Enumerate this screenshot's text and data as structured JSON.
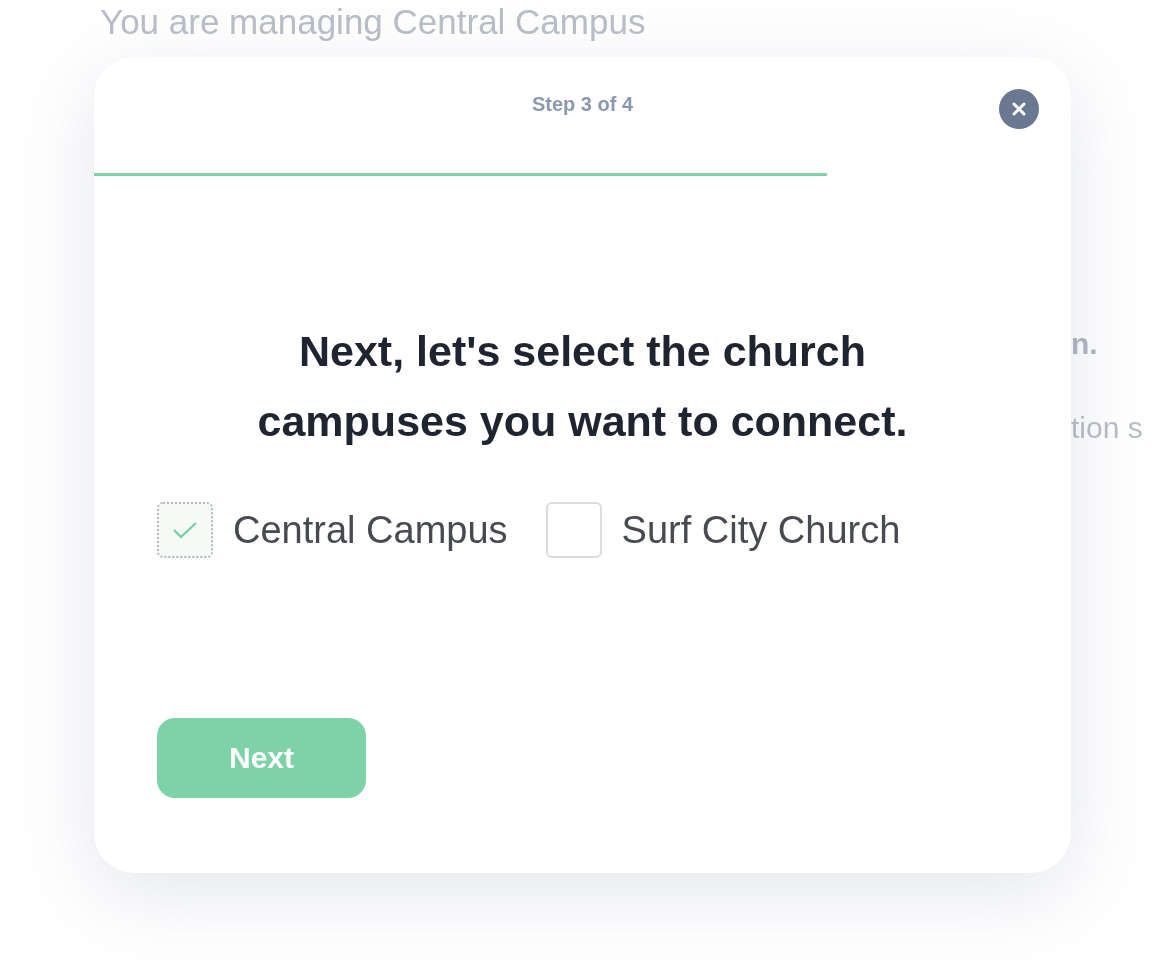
{
  "background": {
    "heading": "You are managing Central Campus",
    "fragments": [
      "n.",
      "tion s"
    ]
  },
  "modal": {
    "step": "Step 3 of 4",
    "progress": {
      "level": 0.75
    },
    "title": "Next, let's select the church campuses you want to connect.",
    "campuses": [
      {
        "label": "Central Campus",
        "checked": true
      },
      {
        "label": "Surf City Church",
        "checked": false
      }
    ],
    "button": "Next"
  }
}
